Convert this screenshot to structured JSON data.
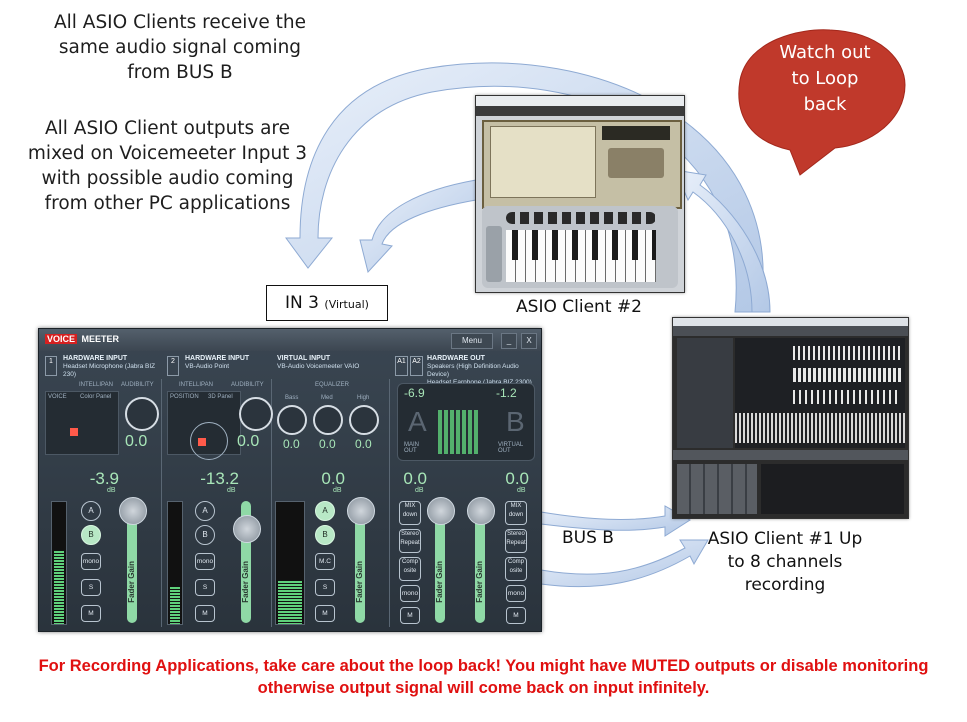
{
  "notes": {
    "top": "All ASIO Clients receive the same audio signal coming from BUS B",
    "middle": "All ASIO Client outputs are mixed on Voicemeeter Input 3 with possible audio coming from other PC applications"
  },
  "bubble": "Watch out to Loop back",
  "in3_box": {
    "main": "IN 3",
    "sub": "(Virtual)"
  },
  "client2_label": "ASIO Client #2",
  "client1_label": "ASIO Client #1 Up to 8 channels recording",
  "bus_label": "BUS B",
  "warning": "For Recording Applications, take care about the loop back! You might have MUTED outputs or disable monitoring otherwise output signal will come back on input infinitely.",
  "colors": {
    "warning": "#e01010",
    "bubble": "#c0392b",
    "arrow": "#b7cbe6",
    "fader": "#8fd9a6"
  },
  "voicemeeter": {
    "logo_a": "VOICE",
    "logo_b": "MEETER",
    "menu": "Menu",
    "min": "_",
    "close": "X",
    "strips": [
      {
        "num": "1",
        "title": "HARDWARE INPUT",
        "device": "Headset Microphone (Jabra BIZ 230)",
        "value": "0.0",
        "gain": "-3.9",
        "buttons": [
          "A",
          "B",
          "mono",
          "S",
          "M"
        ]
      },
      {
        "num": "2",
        "title": "HARDWARE INPUT",
        "device": "VB-Audio Point",
        "value": "0.0",
        "gain": "-13.2",
        "buttons": [
          "A",
          "B",
          "mono",
          "S",
          "M"
        ]
      },
      {
        "title": "VIRTUAL INPUT",
        "device": "VB-Audio Voicemeeter VAIO",
        "eq_label": "EQUALIZER",
        "eq": [
          "Bass",
          "Med",
          "High"
        ],
        "eq_vals": [
          "0.0",
          "0.0",
          "0.0"
        ],
        "gain": "0.0",
        "buttons": [
          "A",
          "B",
          "M.C",
          "S",
          "M"
        ]
      }
    ],
    "hw_out": {
      "tags": [
        "A1",
        "A2"
      ],
      "title": "HARDWARE OUT",
      "line1": "Speakers (High Definition Audio Device)",
      "line2": "Headset Earphone (Jabra BIZ 2300)",
      "a_level": "-6.9",
      "b_level": "-1.2",
      "a_big": "A",
      "b_big": "B",
      "a_sub": "MAIN OUT",
      "b_sub": "VIRTUAL OUT",
      "gain_a": "0.0",
      "gain_b": "0.0",
      "buttons": [
        "MIX down",
        "Stereo Repeat",
        "Comp osite",
        "mono",
        "M"
      ]
    },
    "labels": {
      "intellipan": "INTELLIPAN",
      "audibility": "AUDIBILITY",
      "voice": "VOICE",
      "color_panel": "Color Panel",
      "position": "POSITION",
      "3d_panel": "3D Panel",
      "fader_gain": "Fader Gain",
      "db": "dB"
    }
  }
}
